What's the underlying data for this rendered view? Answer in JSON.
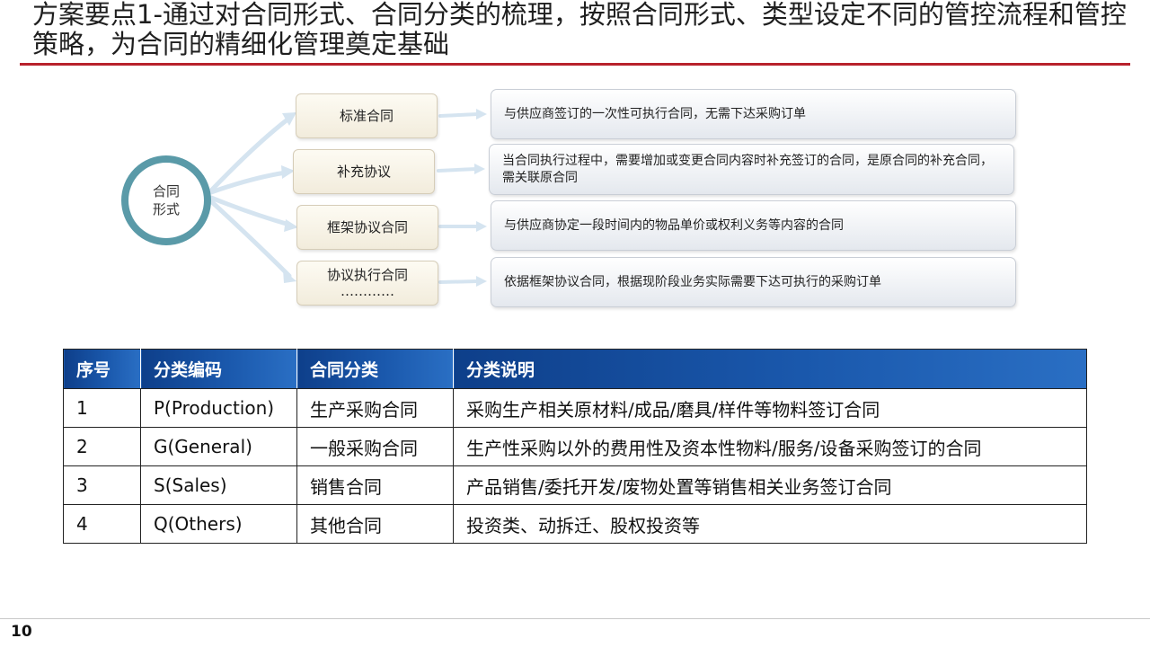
{
  "slide": {
    "title": "方案要点1-通过对合同形式、合同分类的梳理，按照合同形式、类型设定不同的管控流程和管控策略，为合同的精细化管理奠定基础",
    "page_number": "10",
    "accent_color": "#b8222c"
  },
  "diagram": {
    "center_lines": [
      "合同",
      "形式"
    ],
    "types": [
      {
        "label": "标准合同",
        "sublabel": "",
        "description": "与供应商签订的一次性可执行合同，无需下达采购订单"
      },
      {
        "label": "补充协议",
        "sublabel": "",
        "description": "当合同执行过程中，需要增加或变更合同内容时补充签订的合同，是原合同的补充合同，需关联原合同"
      },
      {
        "label": "框架协议合同",
        "sublabel": "",
        "description": "与供应商协定一段时间内的物品单价或权利义务等内容的合同"
      },
      {
        "label": "协议执行合同",
        "sublabel": "…………",
        "description": "依据框架协议合同，根据现阶段业务实际需要下达可执行的采购订单"
      }
    ]
  },
  "table": {
    "header_color": "#1a58ac",
    "columns": [
      "序号",
      "分类编码",
      "合同分类",
      "分类说明"
    ],
    "rows": [
      [
        "1",
        "P(Production)",
        "生产采购合同",
        "采购生产相关原材料/成品/磨具/样件等物料签订合同"
      ],
      [
        "2",
        "G(General)",
        "一般采购合同",
        "生产性采购以外的费用性及资本性物料/服务/设备采购签订的合同"
      ],
      [
        "3",
        "S(Sales)",
        "销售合同",
        "产品销售/委托开发/废物处置等销售相关业务签订合同"
      ],
      [
        "4",
        "Q(Others)",
        "其他合同",
        "投资类、动拆迁、股权投资等"
      ]
    ]
  }
}
